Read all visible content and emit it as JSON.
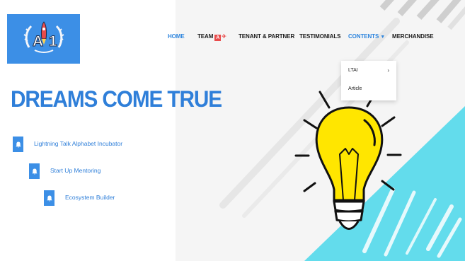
{
  "nav": {
    "items": [
      {
        "label": "HOME",
        "active": true
      },
      {
        "label": "TEAM"
      },
      {
        "label": "TENANT & PARTNER"
      },
      {
        "label": "TESTIMONIALS"
      },
      {
        "label": "CONTENTS",
        "has_dropdown": true
      },
      {
        "label": "MERCHANDISE"
      }
    ],
    "team_badge": "A"
  },
  "dropdown": {
    "items": [
      {
        "label": "LTAI",
        "has_submenu": true
      },
      {
        "label": "Article"
      }
    ]
  },
  "hero": {
    "headline": "DREAMS COME TRUE",
    "features": [
      "Lightning Talk Alphabet Incubator",
      "Start Up Mentoring",
      "Ecosystem Builder"
    ]
  },
  "logo": {
    "letters": "A",
    "digit": "1"
  },
  "colors": {
    "brand_blue": "#2f7fd9",
    "logo_bg": "#3c8fe6",
    "cyan_accent": "#63dcec",
    "bulb_yellow": "#ffe600",
    "nav_active": "#2f86de",
    "team_badge": "#e94b4b"
  },
  "icons": [
    "bell-icon",
    "chevron-right-icon",
    "caret-down-icon",
    "rocket-icon",
    "lightbulb-icon"
  ]
}
